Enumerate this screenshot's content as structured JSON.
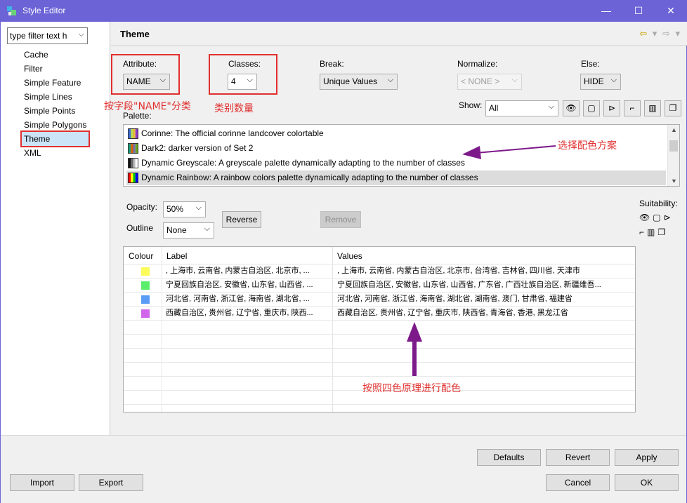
{
  "window": {
    "title": "Style Editor",
    "controls": {
      "minimize": "—",
      "maximize": "☐",
      "close": "✕"
    }
  },
  "sidebar": {
    "filter_placeholder": "type filter text h",
    "items": [
      "Cache",
      "Filter",
      "Simple Feature",
      "Simple Lines",
      "Simple Points",
      "Simple Polygons",
      "Theme",
      "XML"
    ],
    "selected": "Theme"
  },
  "header": {
    "title": "Theme",
    "back_icon": "⇦",
    "forward_icon": "⇨",
    "dropdown_glyph": "▾"
  },
  "theme": {
    "attribute": {
      "label": "Attribute:",
      "value": "NAME"
    },
    "classes": {
      "label": "Classes:",
      "value": "4"
    },
    "break": {
      "label": "Break:",
      "value": "Unique Values"
    },
    "normalize": {
      "label": "Normalize:",
      "value": "< NONE >"
    },
    "else": {
      "label": "Else:",
      "value": "HIDE"
    },
    "palette_label": "Palette:",
    "show": {
      "label": "Show:",
      "value": "All"
    },
    "show_icons": [
      "eye-icon",
      "monitor-icon",
      "projector-icon",
      "printer-icon",
      "book-icon",
      "copy-icon"
    ],
    "palettes": [
      {
        "name": "Corinne: The official corinne landcover colortable",
        "colors": [
          "#3b6bd6",
          "#b8d94a",
          "#e8b83a",
          "#8d3ac6"
        ]
      },
      {
        "name": "Dark2: darker version of Set 2",
        "colors": [
          "#1b9e77",
          "#d95f02",
          "#7570b3",
          "#66a61e"
        ]
      },
      {
        "name": "Dynamic Greyscale: A greyscale palette dynamically adapting to the number of classes",
        "colors": [
          "#111111",
          "#666666",
          "#bbbbbb",
          "#ffffff"
        ]
      },
      {
        "name": "Dynamic Rainbow: A rainbow colors palette dynamically adapting to the number of classes",
        "colors": [
          "#ff0000",
          "#ffff00",
          "#00c000",
          "#0000ff"
        ]
      }
    ],
    "selected_palette": 3,
    "opacity": {
      "label": "Opacity:",
      "value": "50%"
    },
    "outline": {
      "label": "Outline",
      "value": "None"
    },
    "reverse_label": "Reverse",
    "remove_label": "Remove",
    "suitability_label": "Suitability:",
    "table": {
      "headers": [
        "Colour",
        "Label",
        "Values"
      ],
      "rows": [
        {
          "color": "#fbfb5a",
          "label": ", 上海市, 云南省, 内蒙古自治区, 北京市, ...",
          "values": ", 上海市, 云南省, 内蒙古自治区, 北京市, 台湾省, 吉林省, 四川省, 天津市"
        },
        {
          "color": "#5bee6b",
          "label": "宁夏回族自治区, 安徽省, 山东省, 山西省, ...",
          "values": "宁夏回族自治区, 安徽省, 山东省, 山西省, 广东省, 广西壮族自治区, 新疆维吾..."
        },
        {
          "color": "#5a9cf5",
          "label": "河北省, 河南省, 浙江省, 海南省, 湖北省, ...",
          "values": "河北省, 河南省, 浙江省, 海南省, 湖北省, 湖南省, 澳门, 甘肃省, 福建省"
        },
        {
          "color": "#d066ea",
          "label": "西藏自治区, 贵州省, 辽宁省, 重庆市, 陕西...",
          "values": "西藏自治区, 贵州省, 辽宁省, 重庆市, 陕西省, 青海省, 香港, 黑龙江省"
        }
      ],
      "empty_rows": 6
    }
  },
  "annotations": {
    "attribute": "按字段\"NAME\"分类",
    "classes": "类别数量",
    "palette": "选择配色方案",
    "table": "按照四色原理进行配色",
    "color": "#e0302f",
    "arrow_color": "#7d1a8a"
  },
  "buttons": {
    "defaults": "Defaults",
    "revert": "Revert",
    "apply": "Apply",
    "import": "Import",
    "export": "Export",
    "cancel": "Cancel",
    "ok": "OK"
  }
}
